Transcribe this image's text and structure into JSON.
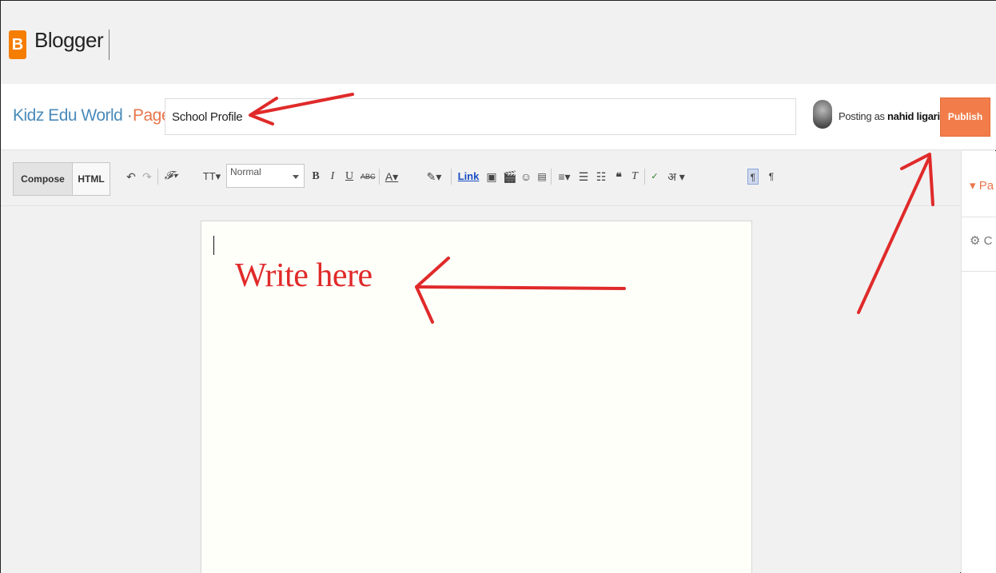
{
  "app": {
    "brand": "Blogger",
    "logo_letter": "B"
  },
  "header": {
    "blog_name": "Kidz Edu World",
    "separator": "·",
    "section": "Page",
    "title_value": "School Profile",
    "posting_prefix": "Posting as",
    "user_name": "nahid ligari",
    "publish_label": "Publish"
  },
  "toolbar": {
    "compose_label": "Compose",
    "html_label": "HTML",
    "format_value": "Normal",
    "link_label": "Link"
  },
  "side_panel": {
    "item1": "▾ Pa",
    "item2": "⚙ C"
  },
  "annotation": {
    "text": "Write here",
    "color": "#e02a2a"
  },
  "colors": {
    "accent_orange": "#f27d4a",
    "blog_blue": "#4a8bba",
    "brand_orange": "#f57d00"
  }
}
